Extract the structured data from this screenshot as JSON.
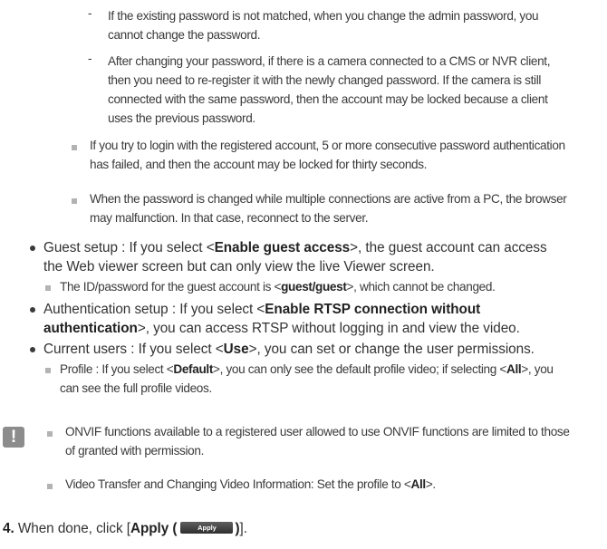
{
  "notes": {
    "dash1_l1": "If the existing password is not matched, when you change the admin password, you",
    "dash1_l2": "cannot change the password.",
    "dash2_l1": "After changing your password, if there is a camera connected to a CMS or NVR client,",
    "dash2_l2": "then you need to re-register it with the newly changed password. If the camera is still",
    "dash2_l3": "connected with the same password, then the account may be locked because a client",
    "dash2_l4": "uses the previous password.",
    "sq1_l1": "If you try to login with the registered account, 5 or more consecutive password authentication",
    "sq1_l2": "has failed, and then the account may be locked for thirty seconds.",
    "sq2_l1": "When the password is changed while multiple connections are active from a PC, the browser",
    "sq2_l2": "may malfunction. In that case, reconnect to the server."
  },
  "guest": {
    "pre": "Guest setup : If you select <",
    "bold": "Enable guest access",
    "post": ">, the guest account can access",
    "l2": "the Web viewer screen but can only view the live Viewer screen.",
    "note_pre": "The ID/password for the guest account is <",
    "note_bold": "guest/guest",
    "note_post": ">, which cannot be changed."
  },
  "auth": {
    "pre": "Authentication setup : If you select <",
    "bold1": "Enable RTSP connection without",
    "bold2": "authentication",
    "post": ">, you can access RTSP without logging in and view the video."
  },
  "users": {
    "pre": "Current users : If you select <",
    "bold": "Use",
    "post": ">, you can set or change the user permissions.",
    "profile_pre": "Profile : If you select <",
    "profile_bold1": "Default",
    "profile_mid": ">, you can only see the default profile video; if selecting <",
    "profile_bold2": "All",
    "profile_post": ">, you",
    "profile_l2": "can see the full profile videos."
  },
  "warning": {
    "icon": "!",
    "n1_l1": "ONVIF functions available to a registered user allowed to use ONVIF functions are limited to those",
    "n1_l2": "of granted with permission.",
    "n2_pre": "Video Transfer and Changing Video Information: Set the profile to <",
    "n2_bold": "All",
    "n2_post": ">."
  },
  "step": {
    "num": "4.",
    "pre": "When done, click [",
    "bold": "Apply (",
    "button": "Apply",
    "bold_close": ")",
    "post": "]."
  },
  "colors": {
    "bullet_square": "#b3b3b3",
    "warning_icon_bg": "#8c8c8c",
    "text": "#333333"
  }
}
